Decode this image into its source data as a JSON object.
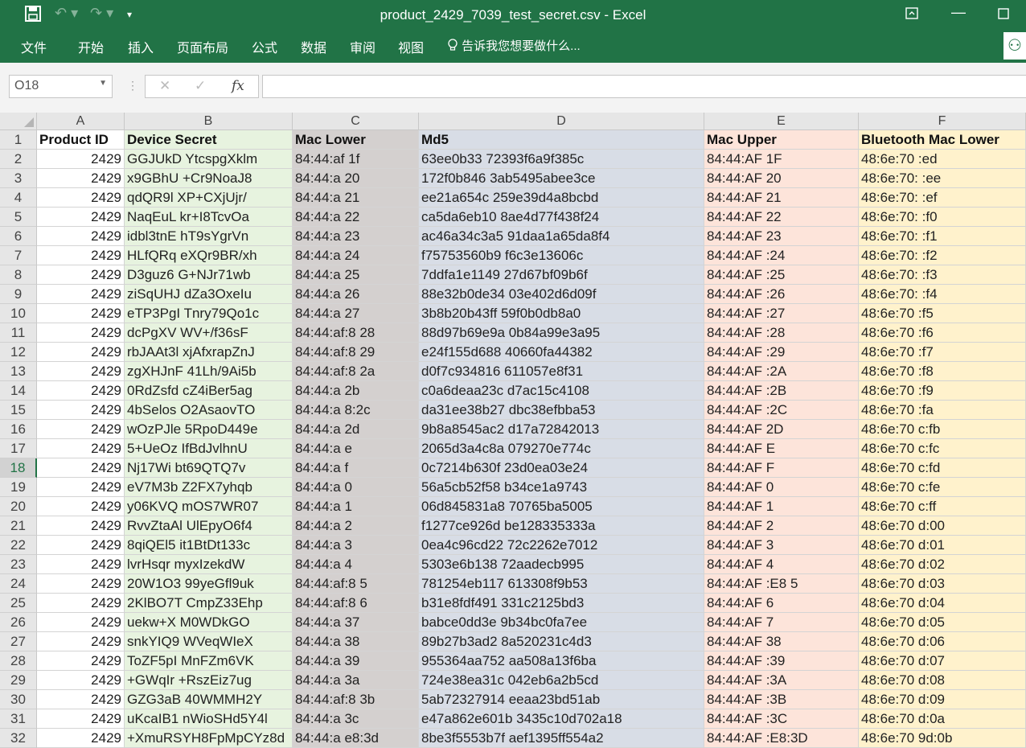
{
  "window": {
    "title": "product_2429_7039_test_secret.csv - Excel"
  },
  "quick_access": {
    "save_icon": "save-icon",
    "undo_icon": "undo-icon",
    "redo_icon": "redo-icon",
    "customize_icon": "customize-icon"
  },
  "ribbon": {
    "tabs": [
      "文件",
      "开始",
      "插入",
      "页面布局",
      "公式",
      "数据",
      "审阅",
      "视图"
    ],
    "tell_me": "告诉我您想要做什么..."
  },
  "formula_bar": {
    "name_box": "O18",
    "formula": ""
  },
  "sheet": {
    "columns": [
      "A",
      "B",
      "C",
      "D",
      "E",
      "F"
    ],
    "column_fills": [
      "#ffffff",
      "#e7f3df",
      "#d4d0cf",
      "#d8dde6",
      "#fde4da",
      "#fff2cc"
    ],
    "selected_row": 18,
    "rows": [
      {
        "n": "1",
        "a": "Product ID",
        "b": "Device Secret",
        "c": "Mac Lower",
        "d": "Md5",
        "e": "Mac Upper",
        "f": "Bluetooth Mac Lower"
      },
      {
        "n": "2",
        "a": "2429",
        "b": "GGJUkD YtcspgXklm",
        "c": "84:44:af 1f",
        "d": "63ee0b33 72393f6a9f385c",
        "e": "84:44:AF 1F",
        "f": "48:6e:70 :ed"
      },
      {
        "n": "3",
        "a": "2429",
        "b": "x9GBhU +Cr9NoaJ8",
        "c": "84:44:a 20",
        "d": "172f0b846 3ab5495abee3ce",
        "e": "84:44:AF 20",
        "f": "48:6e:70: :ee"
      },
      {
        "n": "4",
        "a": "2429",
        "b": "qdQR9l XP+CXjUjr/",
        "c": "84:44:a 21",
        "d": "ee21a654c 259e39d4a8bcbd",
        "e": "84:44:AF 21",
        "f": "48:6e:70: :ef"
      },
      {
        "n": "5",
        "a": "2429",
        "b": "NaqEuL kr+I8TcvOa",
        "c": "84:44:a 22",
        "d": "ca5da6eb10 8ae4d77f438f24",
        "e": "84:44:AF 22",
        "f": "48:6e:70: :f0"
      },
      {
        "n": "6",
        "a": "2429",
        "b": "idbl3tnE hT9sYgrVn",
        "c": "84:44:a 23",
        "d": "ac46a34c3a5 91daa1a65da8f4",
        "e": "84:44:AF 23",
        "f": "48:6e:70: :f1"
      },
      {
        "n": "7",
        "a": "2429",
        "b": "HLfQRq eXQr9BR/xh",
        "c": "84:44:a 24",
        "d": "f75753560b9 f6c3e13606c",
        "e": "84:44:AF :24",
        "f": "48:6e:70: :f2"
      },
      {
        "n": "8",
        "a": "2429",
        "b": "D3guz6 G+NJr71wb",
        "c": "84:44:a 25",
        "d": "7ddfa1e1149 27d67bf09b6f",
        "e": "84:44:AF :25",
        "f": "48:6e:70: :f3"
      },
      {
        "n": "9",
        "a": "2429",
        "b": "ziSqUHJ dZa3OxeIu",
        "c": "84:44:a 26",
        "d": "88e32b0de34 03e402d6d09f",
        "e": "84:44:AF :26",
        "f": "48:6e:70: :f4"
      },
      {
        "n": "10",
        "a": "2429",
        "b": "eTP3PgI Tnry79Qo1c",
        "c": "84:44:a 27",
        "d": "3b8b20b43ff 59f0b0db8a0",
        "e": "84:44:AF :27",
        "f": "48:6e:70 :f5"
      },
      {
        "n": "11",
        "a": "2429",
        "b": "dcPgXV WV+/f36sF",
        "c": "84:44:af:8 28",
        "d": "88d97b69e9a 0b84a99e3a95",
        "e": "84:44:AF :28",
        "f": "48:6e:70 :f6"
      },
      {
        "n": "12",
        "a": "2429",
        "b": "rbJAAt3l xjAfxrapZnJ",
        "c": "84:44:af:8 29",
        "d": "e24f155d688 40660fa44382",
        "e": "84:44:AF :29",
        "f": "48:6e:70 :f7"
      },
      {
        "n": "13",
        "a": "2429",
        "b": "zgXHJnF 41Lh/9Ai5b",
        "c": "84:44:af:8 2a",
        "d": "d0f7c934816 611057e8f31",
        "e": "84:44:AF :2A",
        "f": "48:6e:70 :f8"
      },
      {
        "n": "14",
        "a": "2429",
        "b": "0RdZsfd cZ4iBer5ag",
        "c": "84:44:a 2b",
        "d": "c0a6deaa23c d7ac15c4108",
        "e": "84:44:AF :2B",
        "f": "48:6e:70 :f9"
      },
      {
        "n": "15",
        "a": "2429",
        "b": "4bSelos O2AsaovTO",
        "c": "84:44:a 8:2c",
        "d": "da31ee38b27 dbc38efbba53",
        "e": "84:44:AF :2C",
        "f": "48:6e:70 :fa"
      },
      {
        "n": "16",
        "a": "2429",
        "b": "wOzPJle 5RpoD449e",
        "c": "84:44:a 2d",
        "d": "9b8a8545ac2 d17a72842013",
        "e": "84:44:AF 2D",
        "f": "48:6e:70 c:fb"
      },
      {
        "n": "17",
        "a": "2429",
        "b": "5+UeOz IfBdJvlhnU",
        "c": "84:44:a e",
        "d": "2065d3a4c8a 079270e774c",
        "e": "84:44:AF E",
        "f": "48:6e:70 c:fc"
      },
      {
        "n": "18",
        "a": "2429",
        "b": "Nj17Wi bt69QTQ7v",
        "c": "84:44:a f",
        "d": "0c7214b630f 23d0ea03e24",
        "e": "84:44:AF F",
        "f": "48:6e:70 c:fd"
      },
      {
        "n": "19",
        "a": "2429",
        "b": "eV7M3b Z2FX7yhqb",
        "c": "84:44:a 0",
        "d": "56a5cb52f58 b34ce1a9743",
        "e": "84:44:AF 0",
        "f": "48:6e:70 c:fe"
      },
      {
        "n": "20",
        "a": "2429",
        "b": "y06KVQ mOS7WR07",
        "c": "84:44:a 1",
        "d": "06d845831a8 70765ba5005",
        "e": "84:44:AF 1",
        "f": "48:6e:70 c:ff"
      },
      {
        "n": "21",
        "a": "2429",
        "b": "RvvZtaAl UlEpyO6f4",
        "c": "84:44:a 2",
        "d": "f1277ce926d be128335333a",
        "e": "84:44:AF 2",
        "f": "48:6e:70 d:00"
      },
      {
        "n": "22",
        "a": "2429",
        "b": "8qiQEl5 it1BtDt133c",
        "c": "84:44:a 3",
        "d": "0ea4c96cd22 72c2262e7012",
        "e": "84:44:AF 3",
        "f": "48:6e:70 d:01"
      },
      {
        "n": "23",
        "a": "2429",
        "b": "lvrHsqr myxIzekdW",
        "c": "84:44:a 4",
        "d": "5303e6b138 72aadecb995",
        "e": "84:44:AF 4",
        "f": "48:6e:70 d:02"
      },
      {
        "n": "24",
        "a": "2429",
        "b": "20W1O3 99yeGfl9uk",
        "c": "84:44:af:8 5",
        "d": "781254eb117 613308f9b53",
        "e": "84:44:AF :E8 5",
        "f": "48:6e:70 d:03"
      },
      {
        "n": "25",
        "a": "2429",
        "b": "2KlBO7T CmpZ33Ehp",
        "c": "84:44:af:8 6",
        "d": "b31e8fdf491 331c2125bd3",
        "e": "84:44:AF 6",
        "f": "48:6e:70 d:04"
      },
      {
        "n": "26",
        "a": "2429",
        "b": "uekw+X M0WDkGO",
        "c": "84:44:a 37",
        "d": "babce0dd3e 9b34bc0fa7ee",
        "e": "84:44:AF 7",
        "f": "48:6e:70 d:05"
      },
      {
        "n": "27",
        "a": "2429",
        "b": "snkYIQ9 WVeqWIeX",
        "c": "84:44:a 38",
        "d": "89b27b3ad2 8a520231c4d3",
        "e": "84:44:AF 38",
        "f": "48:6e:70 d:06"
      },
      {
        "n": "28",
        "a": "2429",
        "b": "ToZF5pI MnFZm6VK",
        "c": "84:44:a 39",
        "d": "955364aa752 aa508a13f6ba",
        "e": "84:44:AF :39",
        "f": "48:6e:70 d:07"
      },
      {
        "n": "29",
        "a": "2429",
        "b": "+GWqIr +RszEiz7ug",
        "c": "84:44:a 3a",
        "d": "724e38ea31c 042eb6a2b5cd",
        "e": "84:44:AF :3A",
        "f": "48:6e:70 d:08"
      },
      {
        "n": "30",
        "a": "2429",
        "b": "GZG3aB 40WMMH2Y",
        "c": "84:44:af:8 3b",
        "d": "5ab72327914 eeaa23bd51ab",
        "e": "84:44:AF :3B",
        "f": "48:6e:70 d:09"
      },
      {
        "n": "31",
        "a": "2429",
        "b": "uKcaIB1 nWioSHd5Y4l",
        "c": "84:44:a 3c",
        "d": "e47a862e601b 3435c10d702a18",
        "e": "84:44:AF :3C",
        "f": "48:6e:70 d:0a"
      },
      {
        "n": "32",
        "a": "2429",
        "b": "+XmuRSYH8FpMpCYz8d",
        "c": "84:44:a e8:3d",
        "d": "8be3f5553b7f aef1395ff554a2",
        "e": "84:44:AF :E8:3D",
        "f": "48:6e:70 9d:0b"
      }
    ]
  }
}
